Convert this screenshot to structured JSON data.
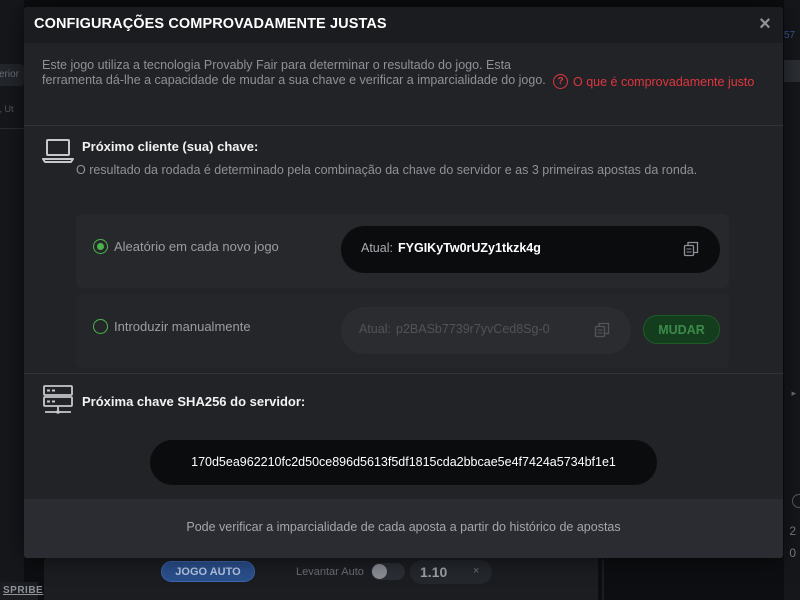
{
  "background": {
    "left_tab_label": "iterior",
    "left_search_placeholder": "ar, Ut",
    "brand": "SPRIBE",
    "right_top_text": "57",
    "right_arrow": "▸",
    "right_numbers": [
      "2",
      "0"
    ],
    "jogo_auto_label": "JOGO AUTO",
    "levantar_auto_label": "Levantar Auto",
    "multiplier_value": "1.10",
    "multiplier_clear": "×"
  },
  "modal": {
    "title": "CONFIGURAÇÕES COMPROVADAMENTE JUSTAS",
    "close_glyph": "×",
    "intro_text": "Este jogo utiliza a tecnologia Provably Fair para determinar o resultado do jogo. Esta ferramenta dá-lhe a capacidade de mudar a sua chave e verificar a imparcialidade do jogo.",
    "help_link": {
      "icon_glyph": "?",
      "label": "O que é comprovadamente justo"
    },
    "client_seed": {
      "title": "Próximo cliente (sua) chave:",
      "description": "O resultado da rodada é determinado pela combinação da chave do servidor e as 3 primeiras apostas da ronda.",
      "random_option": {
        "label": "Aleatório em cada novo jogo",
        "selected": true,
        "current_prefix": "Atual:",
        "current_value": "FYGIKyTw0rUZy1tkzk4g"
      },
      "manual_option": {
        "label": "Introduzir manualmente",
        "selected": false,
        "current_prefix": "Atual:",
        "current_value": "p2BASb7739r7yvCed8Sg-0",
        "button_label": "MUDAR"
      }
    },
    "server_seed": {
      "title": "Próxima chave SHA256 do servidor:",
      "hash": "170d5ea962210fc2d50ce896d5613f5df1815cda2bbcae5e4f7424a5734bf1e1"
    },
    "footer_text": "Pode verificar a imparcialidade de cada aposta a partir do histórico de apostas"
  },
  "colors": {
    "accent_green": "#4bb54b",
    "link_red": "#e0353d",
    "modal_bg": "#222327"
  },
  "icons": {
    "client": "laptop-icon",
    "server": "server-icon",
    "copy": "copy-icon",
    "help": "question-circle-icon",
    "close": "close-icon"
  }
}
